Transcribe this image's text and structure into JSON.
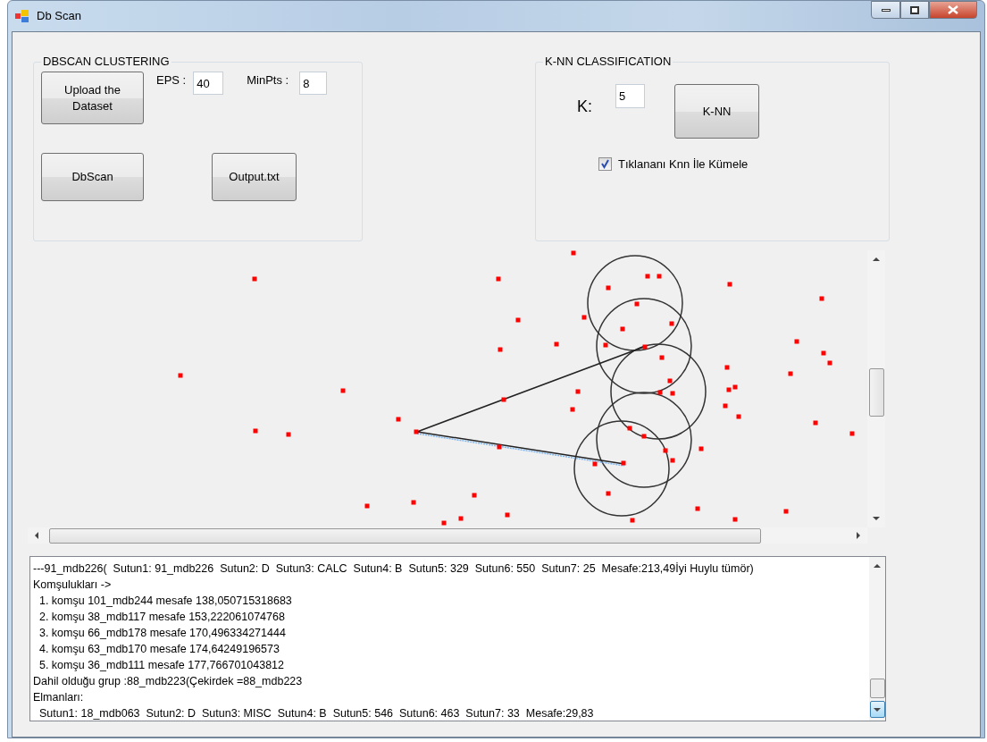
{
  "window": {
    "title": "Db Scan"
  },
  "dbscan": {
    "title": "DBSCAN CLUSTERING",
    "upload_button": "Upload the Dataset",
    "eps_label": "EPS :",
    "eps_value": "40",
    "minpts_label": "MinPts :",
    "minpts_value": "8",
    "dbscan_button": "DbScan",
    "output_button": "Output.txt"
  },
  "knn": {
    "title": "K-NN CLASSIFICATION",
    "k_label": "K:",
    "k_value": "5",
    "knn_button": "K-NN",
    "checkbox": {
      "label": "Tıklananı Knn İle Kümele",
      "checked": true
    }
  },
  "output_lines": [
    "---91_mdb226(  Sutun1: 91_mdb226  Sutun2: D  Sutun3: CALC  Sutun4: B  Sutun5: 329  Sutun6: 550  Sutun7: 25  Mesafe:213,49İyi Huylu tümör)",
    "Komşulukları ->",
    "  1. komşu 101_mdb244 mesafe 138,050715318683",
    "  2. komşu 38_mdb117 mesafe 153,222061074768",
    "  3. komşu 66_mdb178 mesafe 170,496334271444",
    "  4. komşu 63_mdb170 mesafe 174,64249196573",
    "  5. komşu 36_mdb111 mesafe 177,766701043812",
    "Dahil olduğu grup :88_mdb223(Çekirdek =88_mdb223",
    "Elmanları:",
    "  Sutun1: 18_mdb063  Sutun2: D  Sutun3: MISC  Sutun4: B  Sutun5: 546  Sutun6: 463  Sutun7: 33  Mesafe:29,83"
  ]
}
